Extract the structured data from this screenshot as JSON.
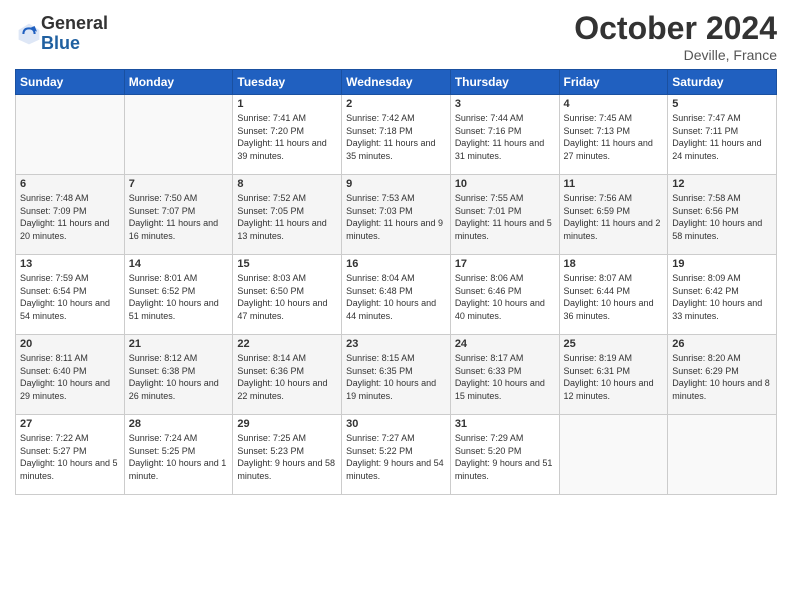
{
  "header": {
    "logo_general": "General",
    "logo_blue": "Blue",
    "month_title": "October 2024",
    "subtitle": "Deville, France"
  },
  "weekdays": [
    "Sunday",
    "Monday",
    "Tuesday",
    "Wednesday",
    "Thursday",
    "Friday",
    "Saturday"
  ],
  "weeks": [
    [
      {
        "day": "",
        "info": ""
      },
      {
        "day": "",
        "info": ""
      },
      {
        "day": "1",
        "info": "Sunrise: 7:41 AM\nSunset: 7:20 PM\nDaylight: 11 hours and 39 minutes."
      },
      {
        "day": "2",
        "info": "Sunrise: 7:42 AM\nSunset: 7:18 PM\nDaylight: 11 hours and 35 minutes."
      },
      {
        "day": "3",
        "info": "Sunrise: 7:44 AM\nSunset: 7:16 PM\nDaylight: 11 hours and 31 minutes."
      },
      {
        "day": "4",
        "info": "Sunrise: 7:45 AM\nSunset: 7:13 PM\nDaylight: 11 hours and 27 minutes."
      },
      {
        "day": "5",
        "info": "Sunrise: 7:47 AM\nSunset: 7:11 PM\nDaylight: 11 hours and 24 minutes."
      }
    ],
    [
      {
        "day": "6",
        "info": "Sunrise: 7:48 AM\nSunset: 7:09 PM\nDaylight: 11 hours and 20 minutes."
      },
      {
        "day": "7",
        "info": "Sunrise: 7:50 AM\nSunset: 7:07 PM\nDaylight: 11 hours and 16 minutes."
      },
      {
        "day": "8",
        "info": "Sunrise: 7:52 AM\nSunset: 7:05 PM\nDaylight: 11 hours and 13 minutes."
      },
      {
        "day": "9",
        "info": "Sunrise: 7:53 AM\nSunset: 7:03 PM\nDaylight: 11 hours and 9 minutes."
      },
      {
        "day": "10",
        "info": "Sunrise: 7:55 AM\nSunset: 7:01 PM\nDaylight: 11 hours and 5 minutes."
      },
      {
        "day": "11",
        "info": "Sunrise: 7:56 AM\nSunset: 6:59 PM\nDaylight: 11 hours and 2 minutes."
      },
      {
        "day": "12",
        "info": "Sunrise: 7:58 AM\nSunset: 6:56 PM\nDaylight: 10 hours and 58 minutes."
      }
    ],
    [
      {
        "day": "13",
        "info": "Sunrise: 7:59 AM\nSunset: 6:54 PM\nDaylight: 10 hours and 54 minutes."
      },
      {
        "day": "14",
        "info": "Sunrise: 8:01 AM\nSunset: 6:52 PM\nDaylight: 10 hours and 51 minutes."
      },
      {
        "day": "15",
        "info": "Sunrise: 8:03 AM\nSunset: 6:50 PM\nDaylight: 10 hours and 47 minutes."
      },
      {
        "day": "16",
        "info": "Sunrise: 8:04 AM\nSunset: 6:48 PM\nDaylight: 10 hours and 44 minutes."
      },
      {
        "day": "17",
        "info": "Sunrise: 8:06 AM\nSunset: 6:46 PM\nDaylight: 10 hours and 40 minutes."
      },
      {
        "day": "18",
        "info": "Sunrise: 8:07 AM\nSunset: 6:44 PM\nDaylight: 10 hours and 36 minutes."
      },
      {
        "day": "19",
        "info": "Sunrise: 8:09 AM\nSunset: 6:42 PM\nDaylight: 10 hours and 33 minutes."
      }
    ],
    [
      {
        "day": "20",
        "info": "Sunrise: 8:11 AM\nSunset: 6:40 PM\nDaylight: 10 hours and 29 minutes."
      },
      {
        "day": "21",
        "info": "Sunrise: 8:12 AM\nSunset: 6:38 PM\nDaylight: 10 hours and 26 minutes."
      },
      {
        "day": "22",
        "info": "Sunrise: 8:14 AM\nSunset: 6:36 PM\nDaylight: 10 hours and 22 minutes."
      },
      {
        "day": "23",
        "info": "Sunrise: 8:15 AM\nSunset: 6:35 PM\nDaylight: 10 hours and 19 minutes."
      },
      {
        "day": "24",
        "info": "Sunrise: 8:17 AM\nSunset: 6:33 PM\nDaylight: 10 hours and 15 minutes."
      },
      {
        "day": "25",
        "info": "Sunrise: 8:19 AM\nSunset: 6:31 PM\nDaylight: 10 hours and 12 minutes."
      },
      {
        "day": "26",
        "info": "Sunrise: 8:20 AM\nSunset: 6:29 PM\nDaylight: 10 hours and 8 minutes."
      }
    ],
    [
      {
        "day": "27",
        "info": "Sunrise: 7:22 AM\nSunset: 5:27 PM\nDaylight: 10 hours and 5 minutes."
      },
      {
        "day": "28",
        "info": "Sunrise: 7:24 AM\nSunset: 5:25 PM\nDaylight: 10 hours and 1 minute."
      },
      {
        "day": "29",
        "info": "Sunrise: 7:25 AM\nSunset: 5:23 PM\nDaylight: 9 hours and 58 minutes."
      },
      {
        "day": "30",
        "info": "Sunrise: 7:27 AM\nSunset: 5:22 PM\nDaylight: 9 hours and 54 minutes."
      },
      {
        "day": "31",
        "info": "Sunrise: 7:29 AM\nSunset: 5:20 PM\nDaylight: 9 hours and 51 minutes."
      },
      {
        "day": "",
        "info": ""
      },
      {
        "day": "",
        "info": ""
      }
    ]
  ]
}
